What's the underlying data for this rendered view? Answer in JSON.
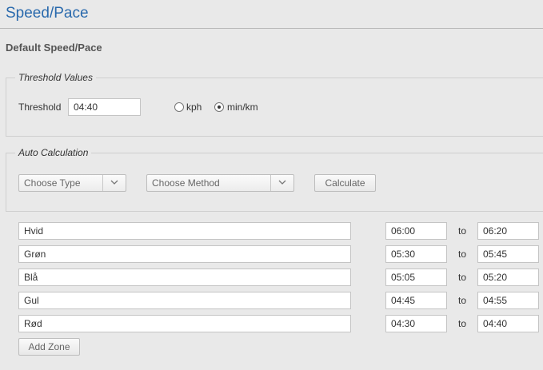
{
  "header": {
    "title": "Speed/Pace"
  },
  "section": {
    "title": "Default Speed/Pace"
  },
  "threshold": {
    "legend": "Threshold Values",
    "label": "Threshold",
    "value": "04:40",
    "units": [
      {
        "label": "kph",
        "selected": false
      },
      {
        "label": "min/km",
        "selected": true
      }
    ]
  },
  "auto_calc": {
    "legend": "Auto Calculation",
    "type_select": "Choose Type",
    "method_select": "Choose Method",
    "calculate_label": "Calculate"
  },
  "zones": {
    "to_label": "to",
    "rows": [
      {
        "name": "Hvid",
        "from": "06:00",
        "to": "06:20"
      },
      {
        "name": "Grøn",
        "from": "05:30",
        "to": "05:45"
      },
      {
        "name": "Blå",
        "from": "05:05",
        "to": "05:20"
      },
      {
        "name": "Gul",
        "from": "04:45",
        "to": "04:55"
      },
      {
        "name": "Rød",
        "from": "04:30",
        "to": "04:40"
      }
    ],
    "add_label": "Add Zone"
  },
  "colors": {
    "title": "#2a6aad",
    "background": "#e9e9e9"
  }
}
